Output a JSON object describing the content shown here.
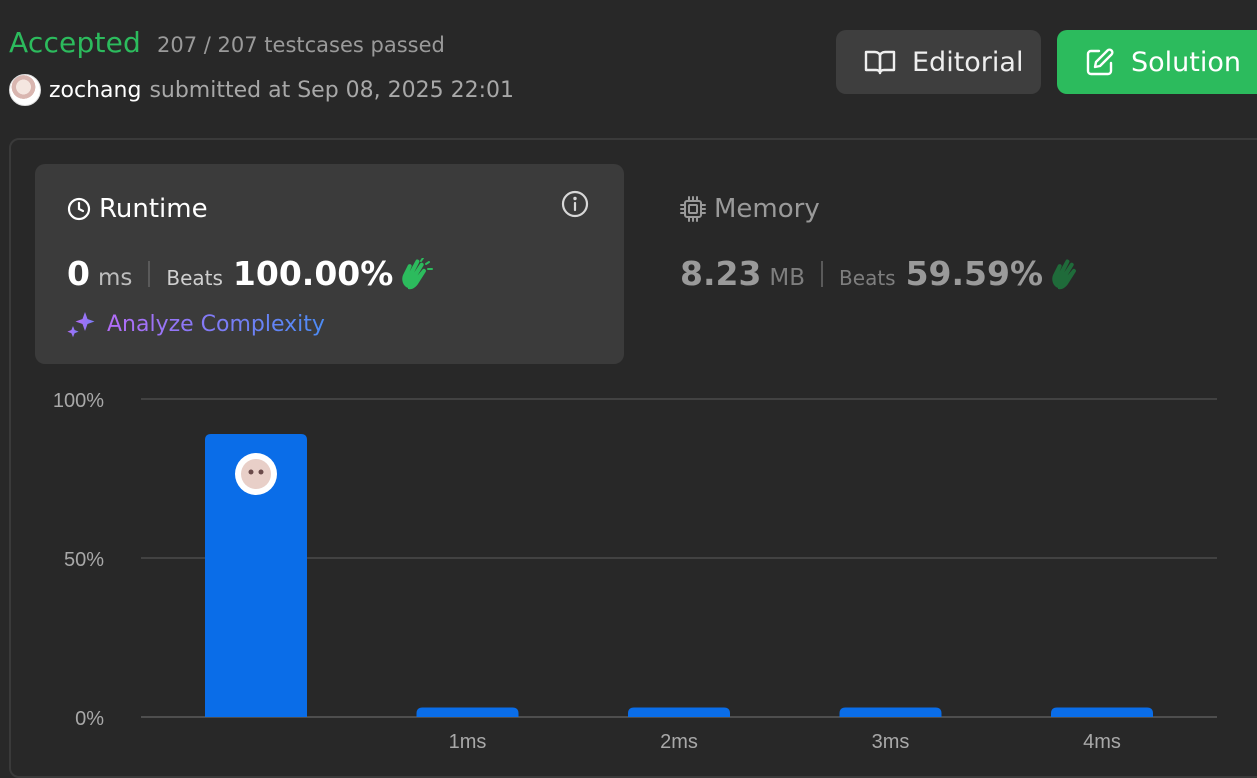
{
  "header": {
    "status": "Accepted",
    "testcases": "207 / 207 testcases passed",
    "username": "zochang",
    "submitted": "submitted at Sep 08, 2025 22:01"
  },
  "buttons": {
    "editorial": "Editorial",
    "solution": "Solution"
  },
  "runtime": {
    "title": "Runtime",
    "value": "0",
    "unit": "ms",
    "beats_label": "Beats",
    "beats_value": "100.00%",
    "analyze_label": "Analyze Complexity"
  },
  "memory": {
    "title": "Memory",
    "value": "8.23",
    "unit": "MB",
    "beats_label": "Beats",
    "beats_value": "59.59%"
  },
  "colors": {
    "accepted": "#2cbb5d",
    "bar": "#0a6de8",
    "clap_active": "#2cbb5d",
    "clap_muted": "#1f6b3a"
  },
  "chart_data": {
    "type": "bar",
    "categories": [
      "",
      "1ms",
      "2ms",
      "3ms",
      "4ms"
    ],
    "values": [
      89,
      3,
      3,
      3,
      3
    ],
    "y_ticks": [
      "0%",
      "50%",
      "100%"
    ],
    "ylim": [
      0,
      100
    ],
    "grid": true,
    "xlabel": "",
    "ylabel": "",
    "title": "",
    "highlight_index": 0
  }
}
